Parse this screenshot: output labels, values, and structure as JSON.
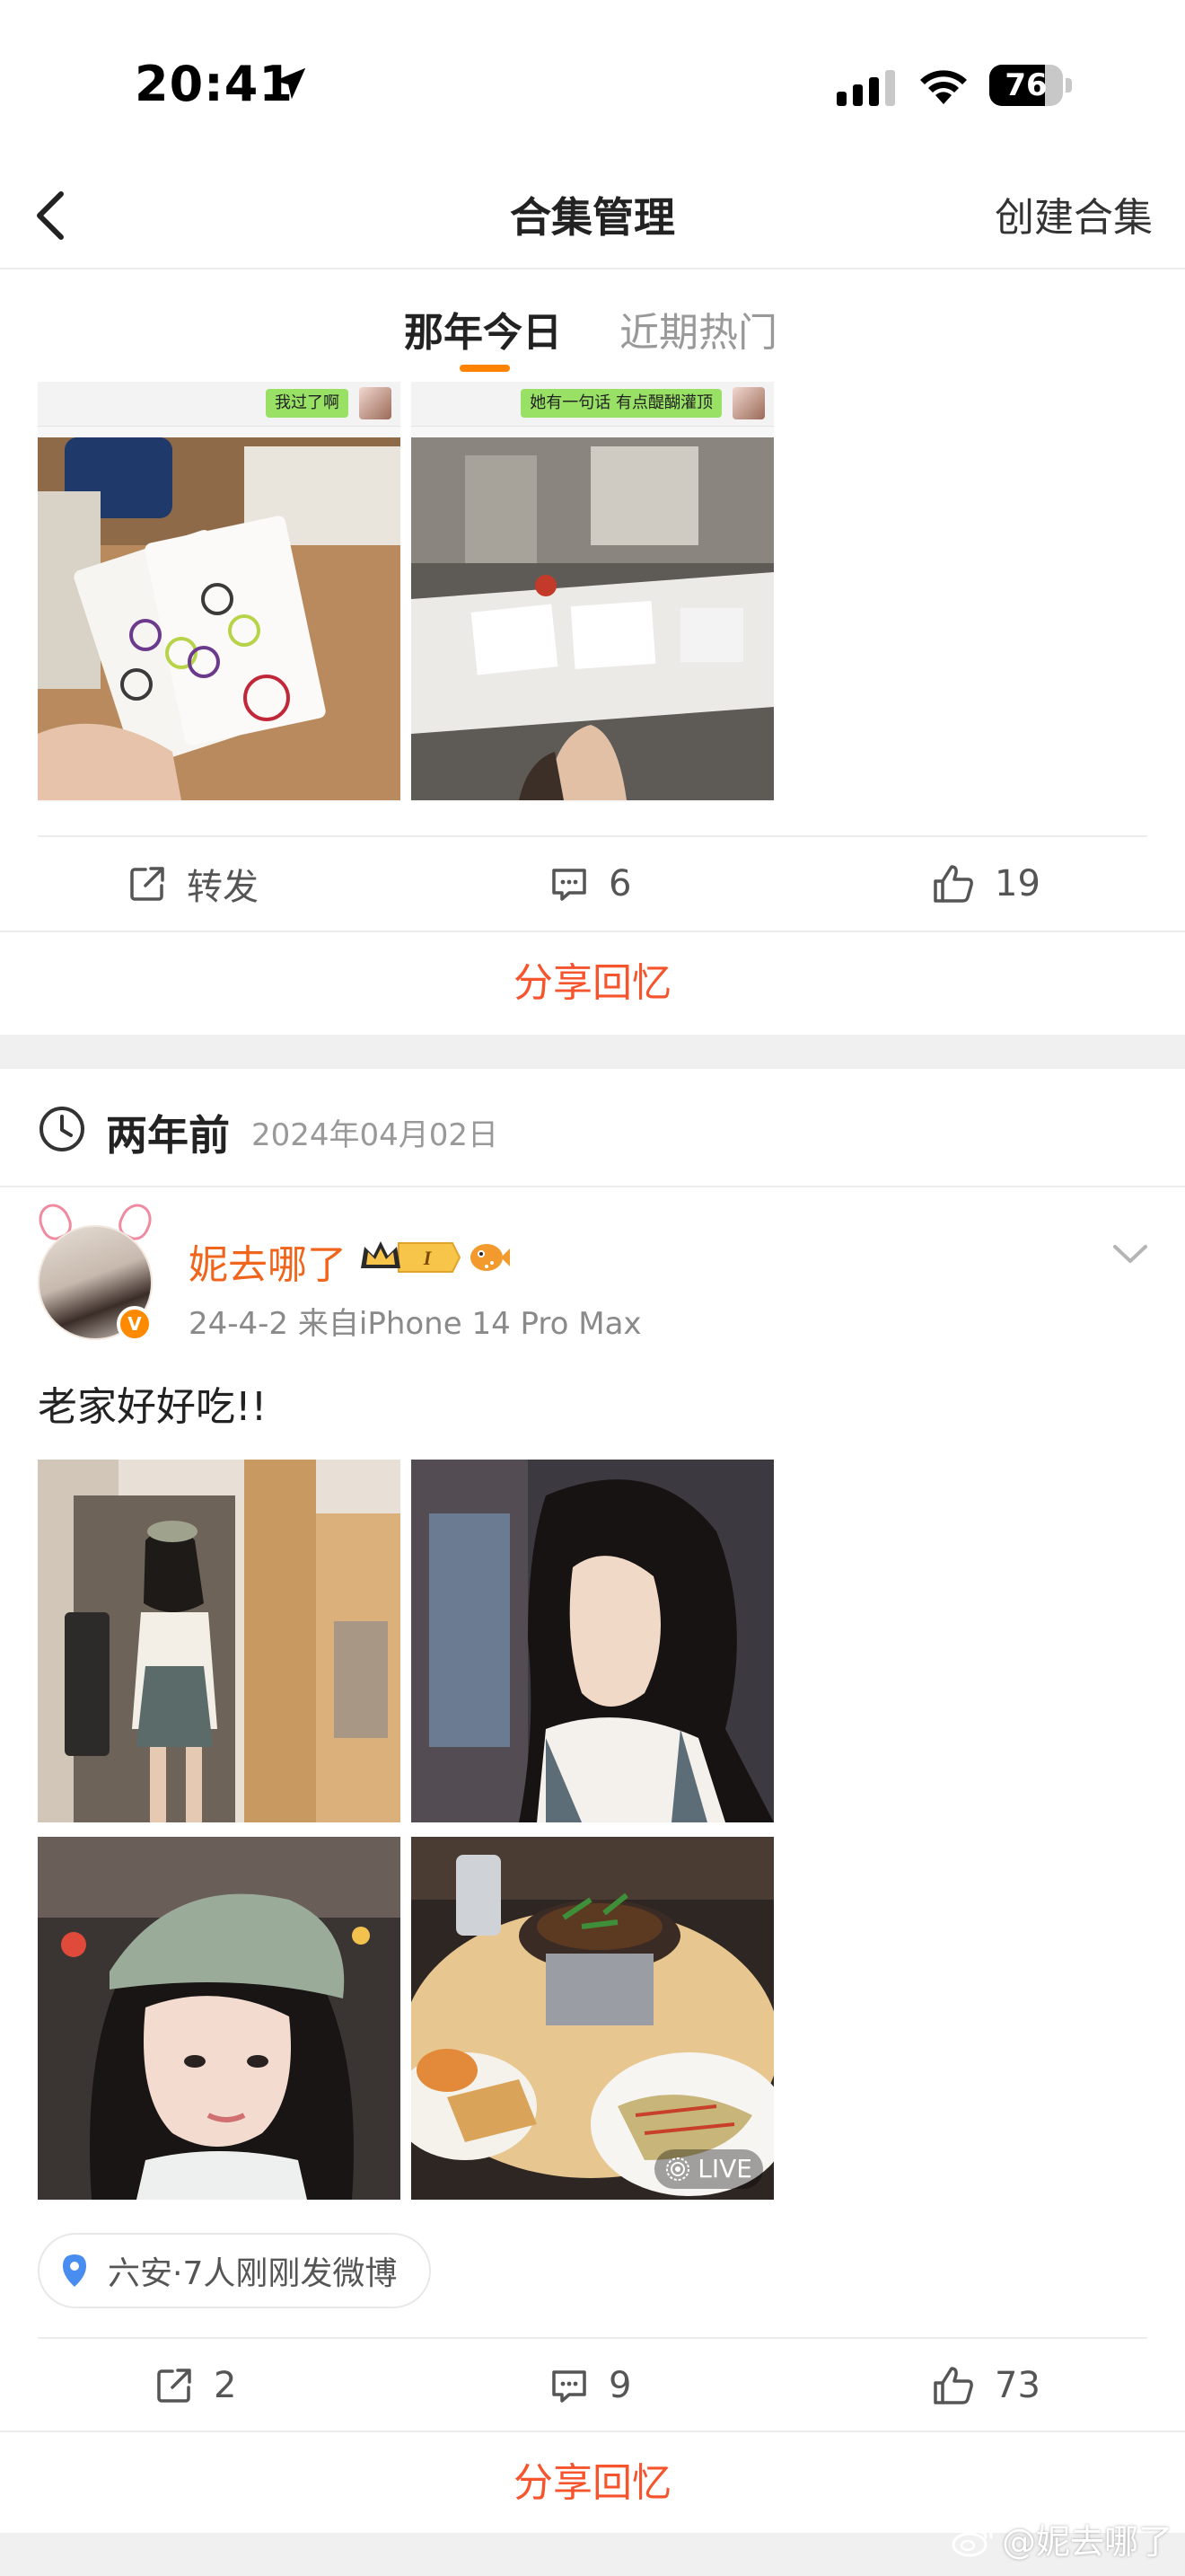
{
  "status_bar": {
    "time": "20:41",
    "battery": "76",
    "battery_level": 0.76
  },
  "nav": {
    "title": "合集管理",
    "action": "创建合集"
  },
  "tabs": [
    {
      "label": "那年今日",
      "active": true
    },
    {
      "label": "近期热门",
      "active": false
    }
  ],
  "previous_post": {
    "chat_bubbles": [
      "我过了啊",
      "她有一句话 有点醍醐灌顶"
    ],
    "actions": {
      "repost": "转发",
      "comments": "6",
      "likes": "19"
    },
    "share_label": "分享回忆"
  },
  "memory": {
    "title": "两年前",
    "date": "2024年04月02日"
  },
  "post": {
    "username": "妮去哪了",
    "badge_level": "I",
    "meta": "24-4-2  来自iPhone 14 Pro Max",
    "text": "老家好好吃!!",
    "live_label": "LIVE",
    "location": "六安·7人刚刚发微博",
    "actions": {
      "reposts": "2",
      "comments": "9",
      "likes": "73"
    },
    "share_label": "分享回忆"
  },
  "watermark": "@妮去哪了",
  "colors": {
    "accent_orange": "#ff8200",
    "share_red": "#f5542d",
    "username_orange": "#f0651b"
  }
}
